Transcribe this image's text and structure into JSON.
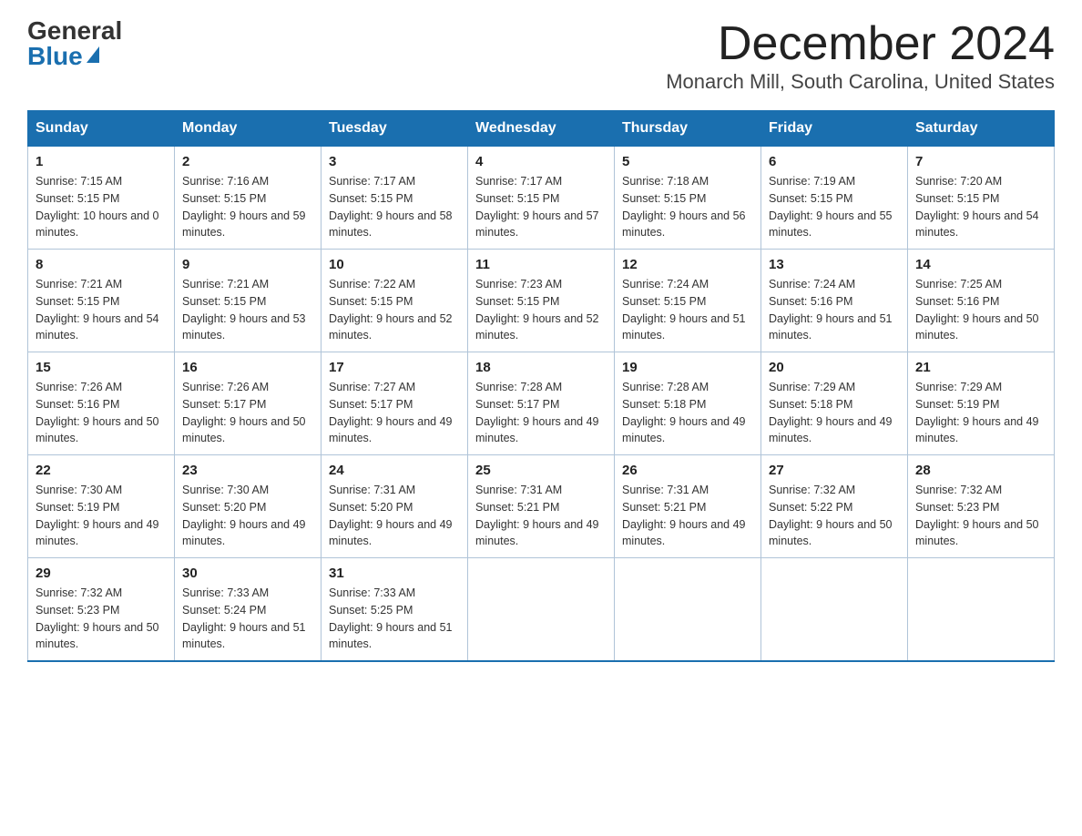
{
  "logo": {
    "general": "General",
    "blue": "Blue"
  },
  "title": {
    "month": "December 2024",
    "location": "Monarch Mill, South Carolina, United States"
  },
  "days_of_week": [
    "Sunday",
    "Monday",
    "Tuesday",
    "Wednesday",
    "Thursday",
    "Friday",
    "Saturday"
  ],
  "weeks": [
    [
      {
        "day": "1",
        "sunrise": "7:15 AM",
        "sunset": "5:15 PM",
        "daylight": "10 hours and 0 minutes."
      },
      {
        "day": "2",
        "sunrise": "7:16 AM",
        "sunset": "5:15 PM",
        "daylight": "9 hours and 59 minutes."
      },
      {
        "day": "3",
        "sunrise": "7:17 AM",
        "sunset": "5:15 PM",
        "daylight": "9 hours and 58 minutes."
      },
      {
        "day": "4",
        "sunrise": "7:17 AM",
        "sunset": "5:15 PM",
        "daylight": "9 hours and 57 minutes."
      },
      {
        "day": "5",
        "sunrise": "7:18 AM",
        "sunset": "5:15 PM",
        "daylight": "9 hours and 56 minutes."
      },
      {
        "day": "6",
        "sunrise": "7:19 AM",
        "sunset": "5:15 PM",
        "daylight": "9 hours and 55 minutes."
      },
      {
        "day": "7",
        "sunrise": "7:20 AM",
        "sunset": "5:15 PM",
        "daylight": "9 hours and 54 minutes."
      }
    ],
    [
      {
        "day": "8",
        "sunrise": "7:21 AM",
        "sunset": "5:15 PM",
        "daylight": "9 hours and 54 minutes."
      },
      {
        "day": "9",
        "sunrise": "7:21 AM",
        "sunset": "5:15 PM",
        "daylight": "9 hours and 53 minutes."
      },
      {
        "day": "10",
        "sunrise": "7:22 AM",
        "sunset": "5:15 PM",
        "daylight": "9 hours and 52 minutes."
      },
      {
        "day": "11",
        "sunrise": "7:23 AM",
        "sunset": "5:15 PM",
        "daylight": "9 hours and 52 minutes."
      },
      {
        "day": "12",
        "sunrise": "7:24 AM",
        "sunset": "5:15 PM",
        "daylight": "9 hours and 51 minutes."
      },
      {
        "day": "13",
        "sunrise": "7:24 AM",
        "sunset": "5:16 PM",
        "daylight": "9 hours and 51 minutes."
      },
      {
        "day": "14",
        "sunrise": "7:25 AM",
        "sunset": "5:16 PM",
        "daylight": "9 hours and 50 minutes."
      }
    ],
    [
      {
        "day": "15",
        "sunrise": "7:26 AM",
        "sunset": "5:16 PM",
        "daylight": "9 hours and 50 minutes."
      },
      {
        "day": "16",
        "sunrise": "7:26 AM",
        "sunset": "5:17 PM",
        "daylight": "9 hours and 50 minutes."
      },
      {
        "day": "17",
        "sunrise": "7:27 AM",
        "sunset": "5:17 PM",
        "daylight": "9 hours and 49 minutes."
      },
      {
        "day": "18",
        "sunrise": "7:28 AM",
        "sunset": "5:17 PM",
        "daylight": "9 hours and 49 minutes."
      },
      {
        "day": "19",
        "sunrise": "7:28 AM",
        "sunset": "5:18 PM",
        "daylight": "9 hours and 49 minutes."
      },
      {
        "day": "20",
        "sunrise": "7:29 AM",
        "sunset": "5:18 PM",
        "daylight": "9 hours and 49 minutes."
      },
      {
        "day": "21",
        "sunrise": "7:29 AM",
        "sunset": "5:19 PM",
        "daylight": "9 hours and 49 minutes."
      }
    ],
    [
      {
        "day": "22",
        "sunrise": "7:30 AM",
        "sunset": "5:19 PM",
        "daylight": "9 hours and 49 minutes."
      },
      {
        "day": "23",
        "sunrise": "7:30 AM",
        "sunset": "5:20 PM",
        "daylight": "9 hours and 49 minutes."
      },
      {
        "day": "24",
        "sunrise": "7:31 AM",
        "sunset": "5:20 PM",
        "daylight": "9 hours and 49 minutes."
      },
      {
        "day": "25",
        "sunrise": "7:31 AM",
        "sunset": "5:21 PM",
        "daylight": "9 hours and 49 minutes."
      },
      {
        "day": "26",
        "sunrise": "7:31 AM",
        "sunset": "5:21 PM",
        "daylight": "9 hours and 49 minutes."
      },
      {
        "day": "27",
        "sunrise": "7:32 AM",
        "sunset": "5:22 PM",
        "daylight": "9 hours and 50 minutes."
      },
      {
        "day": "28",
        "sunrise": "7:32 AM",
        "sunset": "5:23 PM",
        "daylight": "9 hours and 50 minutes."
      }
    ],
    [
      {
        "day": "29",
        "sunrise": "7:32 AM",
        "sunset": "5:23 PM",
        "daylight": "9 hours and 50 minutes."
      },
      {
        "day": "30",
        "sunrise": "7:33 AM",
        "sunset": "5:24 PM",
        "daylight": "9 hours and 51 minutes."
      },
      {
        "day": "31",
        "sunrise": "7:33 AM",
        "sunset": "5:25 PM",
        "daylight": "9 hours and 51 minutes."
      },
      null,
      null,
      null,
      null
    ]
  ]
}
